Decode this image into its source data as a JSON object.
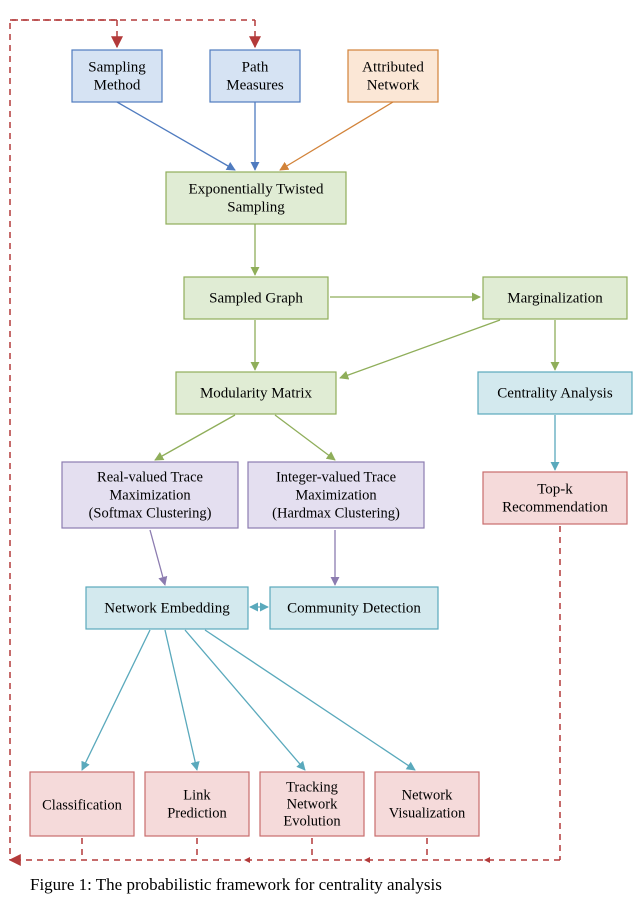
{
  "colors": {
    "blueFill": "#d6e3f3",
    "blueStroke": "#4f7bbf",
    "orangeFill": "#fbe7d6",
    "orangeStroke": "#d2833a",
    "greenFill": "#e0ecd4",
    "greenStroke": "#8fae5a",
    "purpleFill": "#e4dff0",
    "purpleStroke": "#8c7cb0",
    "tealFill": "#d3e9ee",
    "tealStroke": "#5aa9bc",
    "redFill": "#f5dada",
    "redStroke": "#c86c6c",
    "dashStroke": "#b33a3a"
  },
  "nodes": {
    "sampMethod": {
      "l1": "Sampling",
      "l2": "Method"
    },
    "pathMeas": {
      "l1": "Path",
      "l2": "Measures"
    },
    "attrNet": {
      "l1": "Attributed",
      "l2": "Network"
    },
    "expTwist": {
      "l1": "Exponentially Twisted",
      "l2": "Sampling"
    },
    "sampGraph": {
      "l1": "Sampled Graph"
    },
    "marginal": {
      "l1": "Marginalization"
    },
    "modMatrix": {
      "l1": "Modularity Matrix"
    },
    "central": {
      "l1": "Centrality Analysis"
    },
    "realTrace": {
      "l1": "Real-valued Trace",
      "l2": "Maximization",
      "l3": "(Softmax Clustering)"
    },
    "intTrace": {
      "l1": "Integer-valued Trace",
      "l2": "Maximization",
      "l3": "(Hardmax Clustering)"
    },
    "netEmbed": {
      "l1": "Network Embedding"
    },
    "commDet": {
      "l1": "Community Detection"
    },
    "topk": {
      "l1": "Top-k",
      "l2": "Recommendation"
    },
    "classif": {
      "l1": "Classification"
    },
    "linkPred": {
      "l1": "Link",
      "l2": "Prediction"
    },
    "trackEvo": {
      "l1": "Tracking",
      "l2": "Network",
      "l3": "Evolution"
    },
    "netVis": {
      "l1": "Network",
      "l2": "Visualization"
    }
  },
  "caption": "Figure 1: The probabilistic framework for centrality analysis"
}
